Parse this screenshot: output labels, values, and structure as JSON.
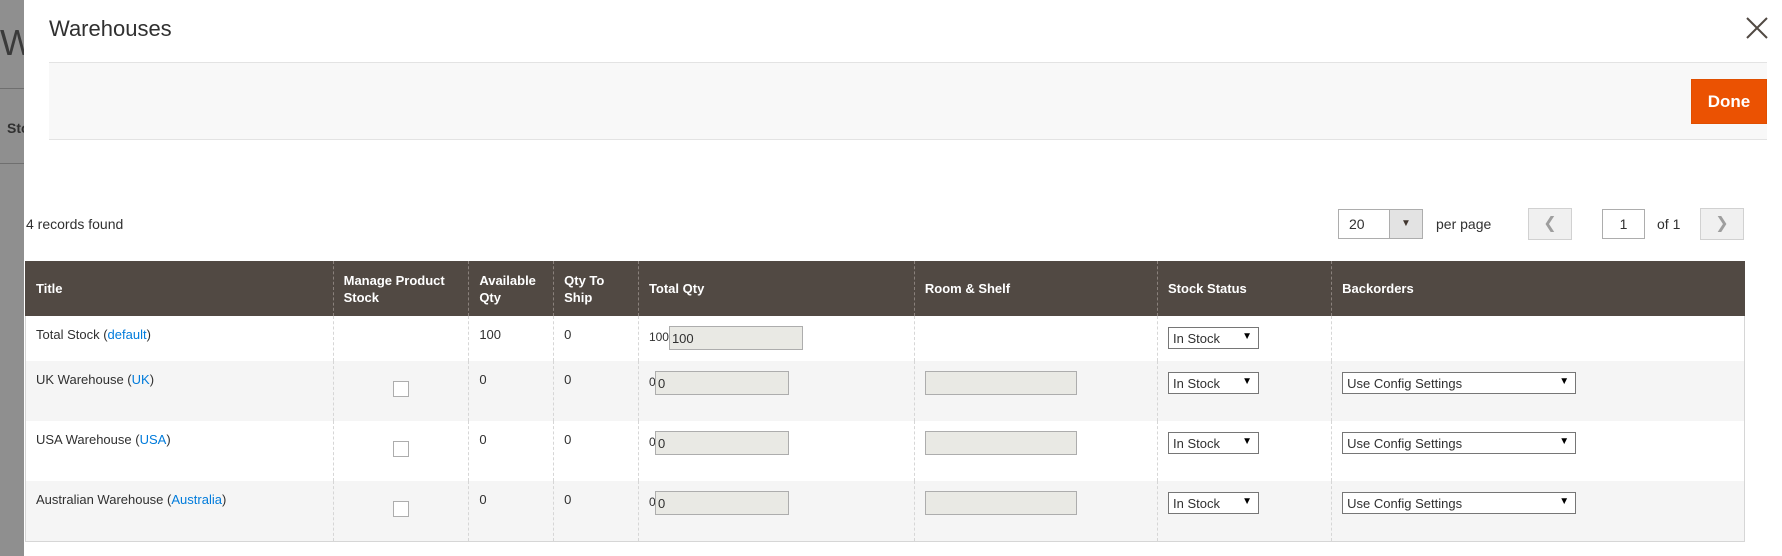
{
  "background": {
    "title_fragment": "Wa",
    "tab_fragment": "Sto"
  },
  "modal": {
    "title": "Warehouses",
    "done_label": "Done"
  },
  "grid": {
    "records_text": "4 records found",
    "per_page_value": "20",
    "per_page_label": "per page",
    "page_value": "1",
    "page_of": "of 1",
    "columns": [
      "Title",
      "Manage Product Stock",
      "Available Qty",
      "Qty To Ship",
      "Total Qty",
      "Room & Shelf",
      "Stock Status",
      "Backorders"
    ],
    "rows": [
      {
        "title": "Total Stock",
        "code": "default",
        "available": "100",
        "to_ship": "0",
        "total_prefix": "100",
        "total_value": "100",
        "stock_status": "In Stock"
      },
      {
        "title": "UK Warehouse",
        "code": "UK",
        "available": "0",
        "to_ship": "0",
        "total_prefix": "0",
        "total_value": "0",
        "stock_status": "In Stock",
        "backorders": "Use Config Settings"
      },
      {
        "title": "USA Warehouse",
        "code": "USA",
        "available": "0",
        "to_ship": "0",
        "total_prefix": "0",
        "total_value": "0",
        "stock_status": "In Stock",
        "backorders": "Use Config Settings"
      },
      {
        "title": "Australian Warehouse",
        "code": "Australia",
        "available": "0",
        "to_ship": "0",
        "total_prefix": "0",
        "total_value": "0",
        "stock_status": "In Stock",
        "backorders": "Use Config Settings"
      }
    ]
  },
  "icons": {
    "close": "close-icon",
    "prev": "chevron-left-icon",
    "next": "chevron-right-icon",
    "dropdown": "caret-down-icon"
  },
  "colors": {
    "accent": "#eb5202",
    "header_bg": "#514943",
    "link": "#007bdb"
  }
}
